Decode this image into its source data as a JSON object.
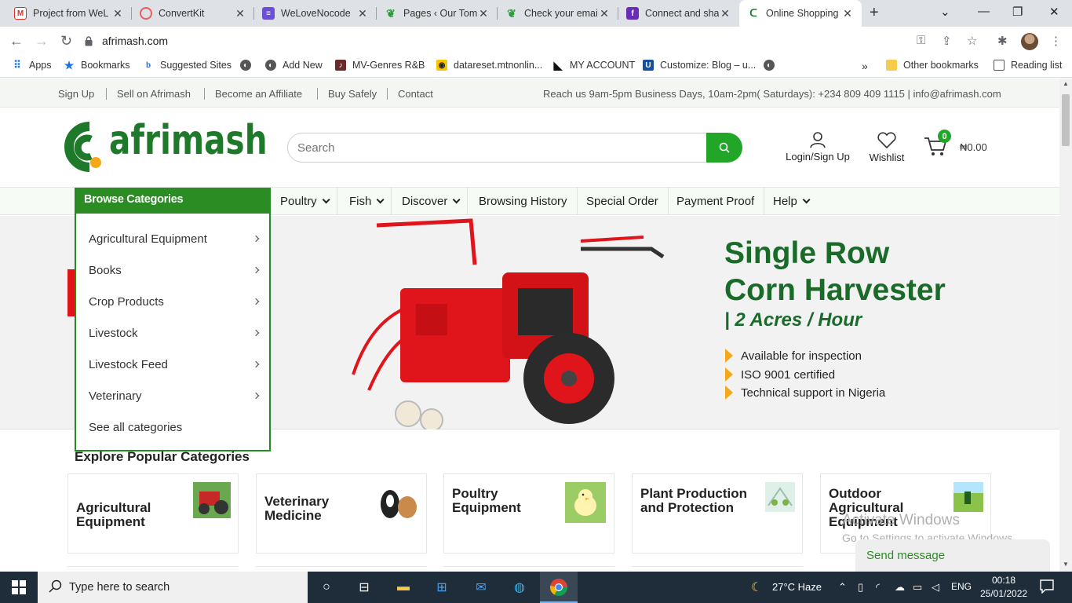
{
  "browser": {
    "tabs": [
      {
        "title": "Project from WeL",
        "favicon": "gmail-icon",
        "active": false
      },
      {
        "title": "ConvertKit",
        "favicon": "convertkit-icon",
        "active": false
      },
      {
        "title": "WeLoveNocode",
        "favicon": "nocode-icon",
        "active": false
      },
      {
        "title": "Pages ‹ Our Tom",
        "favicon": "leaf-icon",
        "active": false
      },
      {
        "title": "Check your email",
        "favicon": "leaf-icon",
        "active": false
      },
      {
        "title": "Connect and sha",
        "favicon": "tumblr-icon",
        "active": false
      },
      {
        "title": "Online Shopping",
        "favicon": "afrimash-icon",
        "active": true
      }
    ],
    "url": "afrimash.com",
    "bookmarks": [
      {
        "label": "Apps",
        "icon": "apps-grid-icon"
      },
      {
        "label": "Bookmarks",
        "icon": "star-icon"
      },
      {
        "label": "Suggested Sites",
        "icon": "bing-icon"
      },
      {
        "label": "",
        "icon": "globe-icon"
      },
      {
        "label": "Add New",
        "icon": "globe-icon"
      },
      {
        "label": "MV-Genres R&B",
        "icon": "music-icon"
      },
      {
        "label": "datareset.mtnonlin...",
        "icon": "mtn-icon"
      },
      {
        "label": "MY ACCOUNT",
        "icon": "account-icon"
      },
      {
        "label": "Customize: Blog – u...",
        "icon": "uf-icon"
      },
      {
        "label": "",
        "icon": "globe-icon"
      }
    ],
    "other_bookmarks": "Other bookmarks",
    "reading_list": "Reading list",
    "more_bookmarks": "»"
  },
  "site": {
    "toplinks": [
      "Sign Up",
      "Sell on Afrimash",
      "Become an Affiliate",
      "Buy Safely",
      "Contact"
    ],
    "contact_info": "Reach us 9am-5pm Business Days, 10am-2pm( Saturdays): +234 809 409 1115 | info@afrimash.com",
    "logo_text": "afrimash",
    "search_placeholder": "Search",
    "login_label": "Login/Sign Up",
    "wishlist_label": "Wishlist",
    "cart_count": "0",
    "cart_total": "₦0.00",
    "nav": [
      {
        "label": "Poultry",
        "has_dropdown": true
      },
      {
        "label": "Fish",
        "has_dropdown": true
      },
      {
        "label": "Discover",
        "has_dropdown": true
      },
      {
        "label": "Browsing History",
        "has_dropdown": false
      },
      {
        "label": "Special Order",
        "has_dropdown": false
      },
      {
        "label": "Payment Proof",
        "has_dropdown": false
      },
      {
        "label": "Help",
        "has_dropdown": true
      }
    ],
    "categories_title": "Browse Categories",
    "categories": [
      "Agricultural Equipment",
      "Books",
      "Crop Products",
      "Livestock",
      "Livestock Feed",
      "Veterinary"
    ],
    "see_all": "See all categories",
    "banner": {
      "title_line1": "Single Row",
      "title_line2": "Corn Harvester",
      "subtitle": "| 2 Acres / Hour",
      "bullets": [
        "Available for inspection",
        "ISO 9001 certified",
        "Technical support in Nigeria"
      ]
    },
    "popular_title": "Explore Popular Categories",
    "popular": [
      {
        "name": "Agricultural Equipment",
        "image": "tractor-thumbnail"
      },
      {
        "name": "Veterinary Medicine",
        "image": "dogs-thumbnail"
      },
      {
        "name": "Poultry Equipment",
        "image": "chick-thumbnail"
      },
      {
        "name": "Plant Production and Protection",
        "image": "greenhouse-thumbnail"
      },
      {
        "name": "Outdoor Agricultural Equipment",
        "image": "field-thumbnail"
      }
    ],
    "send_message": "Send message",
    "activate_windows_title": "Activate Windows",
    "activate_windows_sub": "Go to Settings to activate Windows."
  },
  "taskbar": {
    "search_placeholder": "Type here to search",
    "weather": "27°C  Haze",
    "language": "ENG",
    "time": "00:18",
    "date": "25/01/2022"
  },
  "colors": {
    "brand_green": "#22a628",
    "dark_green": "#1a6b2a",
    "accent_orange": "#f4a91b",
    "banner_red": "#e0151b"
  }
}
